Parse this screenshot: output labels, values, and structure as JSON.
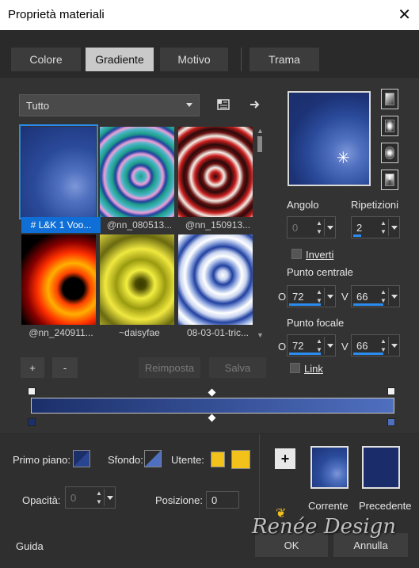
{
  "window": {
    "title": "Proprietà materiali",
    "close_icon": "✕"
  },
  "tabs": [
    {
      "label": "Colore"
    },
    {
      "label": "Gradiente"
    },
    {
      "label": "Motivo"
    },
    {
      "label": "Trama"
    }
  ],
  "library": {
    "selected": "Tutto",
    "items": [
      {
        "caption": "# L&K 1 Voo..."
      },
      {
        "caption": "@nn_080513..."
      },
      {
        "caption": "@nn_150913..."
      },
      {
        "caption": "@nn_240911..."
      },
      {
        "caption": "~daisyfae"
      },
      {
        "caption": "08-03-01-tric..."
      }
    ],
    "add_label": "+",
    "remove_label": "-",
    "reset_label": "Reimposta",
    "save_label": "Salva"
  },
  "gradient": {
    "angle_label": "Angolo",
    "angle_value": "0",
    "repeats_label": "Ripetizioni",
    "repeats_value": "2",
    "invert_label": "Inverti",
    "center_label": "Punto centrale",
    "center_h": "72",
    "center_v": "66",
    "focal_label": "Punto focale",
    "focal_h": "72",
    "focal_v": "66",
    "h_letter": "O",
    "v_letter": "V",
    "link_label": "Link",
    "colors": {
      "start": "#1b2f6a",
      "end": "#4f6fbf"
    }
  },
  "materials": {
    "foreground_label": "Primo piano:",
    "background_label": "Sfondo:",
    "user_label": "Utente:",
    "user_color": "#f2c21a",
    "opacity_label": "Opacità:",
    "opacity_value": "0",
    "position_label": "Posizione:",
    "position_value": "0",
    "current_label": "Corrente",
    "previous_label": "Precedente",
    "previous_color": "#1a2d6a",
    "add_label": "+"
  },
  "footer": {
    "help_label": "Guida",
    "ok_label": "OK",
    "cancel_label": "Annulla",
    "watermark": "Renée Design"
  }
}
